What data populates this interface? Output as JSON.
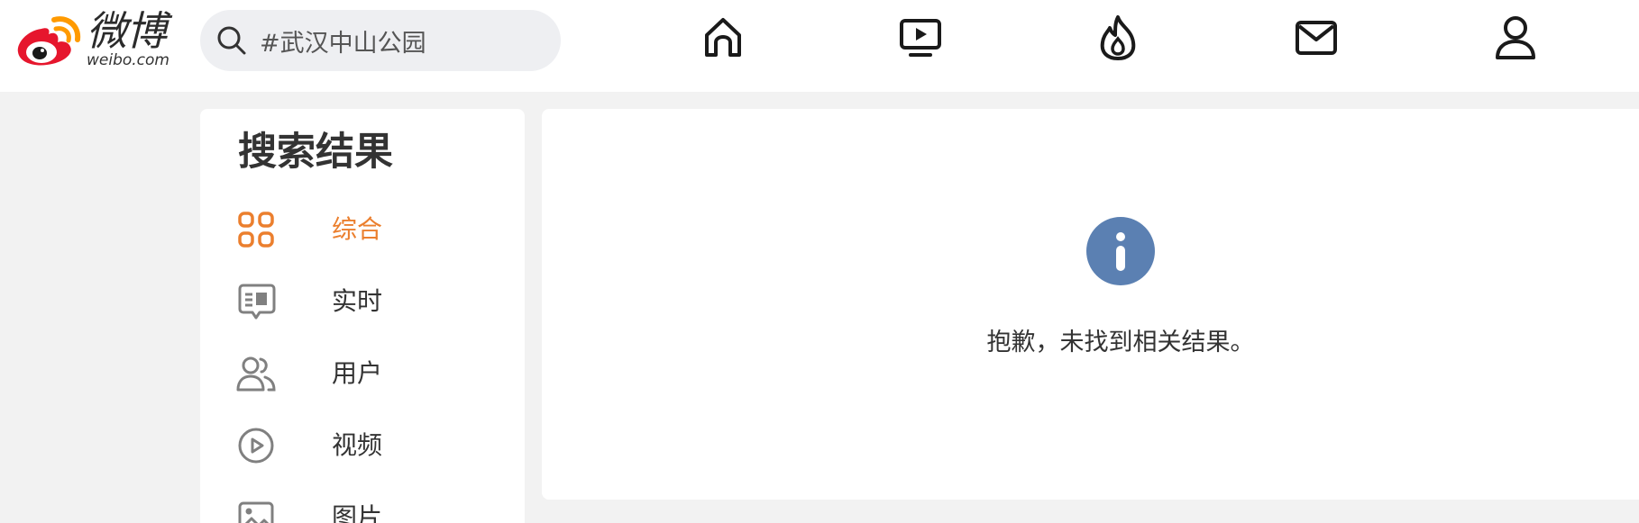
{
  "logo": {
    "cn": "微博",
    "en": "weibo.com"
  },
  "search": {
    "value": "#武汉中山公园",
    "icon": "search-icon"
  },
  "nav": [
    {
      "name": "home-icon"
    },
    {
      "name": "video-icon"
    },
    {
      "name": "hot-icon"
    },
    {
      "name": "mail-icon"
    },
    {
      "name": "profile-icon"
    }
  ],
  "sidebar": {
    "title": "搜索结果",
    "items": [
      {
        "label": "综合",
        "icon": "grid-icon",
        "active": true
      },
      {
        "label": "实时",
        "icon": "realtime-icon",
        "active": false
      },
      {
        "label": "用户",
        "icon": "users-icon",
        "active": false
      },
      {
        "label": "视频",
        "icon": "play-circle-icon",
        "active": false
      },
      {
        "label": "图片",
        "icon": "image-icon",
        "active": false
      }
    ]
  },
  "main": {
    "info_icon": "info-icon",
    "empty_message": "抱歉，未找到相关结果。"
  },
  "colors": {
    "accent": "#eb7f2e",
    "brand_red": "#e6162d",
    "brand_orange": "#ff9a00",
    "info_blue": "#5b80b2",
    "page_bg": "#f2f2f2"
  }
}
